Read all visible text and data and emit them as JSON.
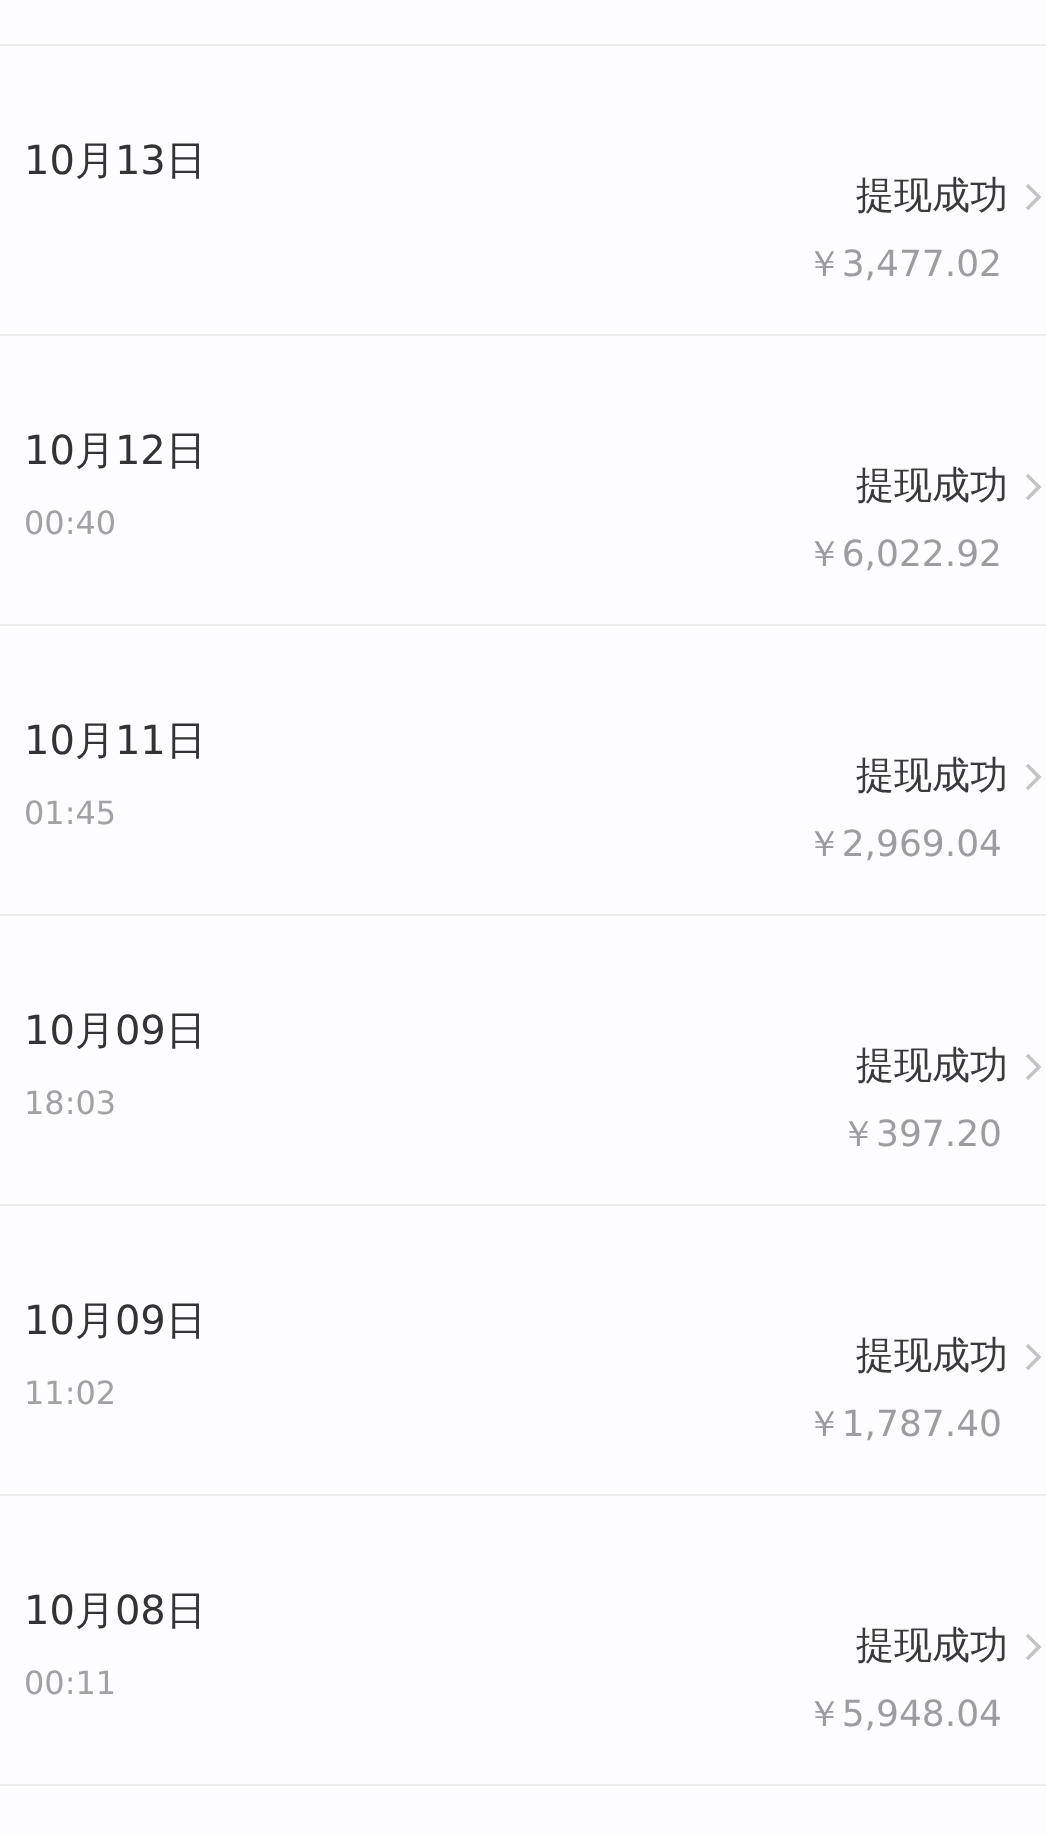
{
  "records": [
    {
      "date": "10月13日",
      "status": "提现成功",
      "amount": "￥3,477.02"
    },
    {
      "date": "10月12日",
      "time": "00:40",
      "status": "提现成功",
      "amount": "￥6,022.92"
    },
    {
      "date": "10月11日",
      "time": "01:45",
      "status": "提现成功",
      "amount": "￥2,969.04"
    },
    {
      "date": "10月09日",
      "time": "18:03",
      "status": "提现成功",
      "amount": "￥397.20"
    },
    {
      "date": "10月09日",
      "time": "11:02",
      "status": "提现成功",
      "amount": "￥1,787.40"
    },
    {
      "date": "10月08日",
      "time": "00:11",
      "status": "提现成功",
      "amount": "￥5,948.04"
    }
  ]
}
